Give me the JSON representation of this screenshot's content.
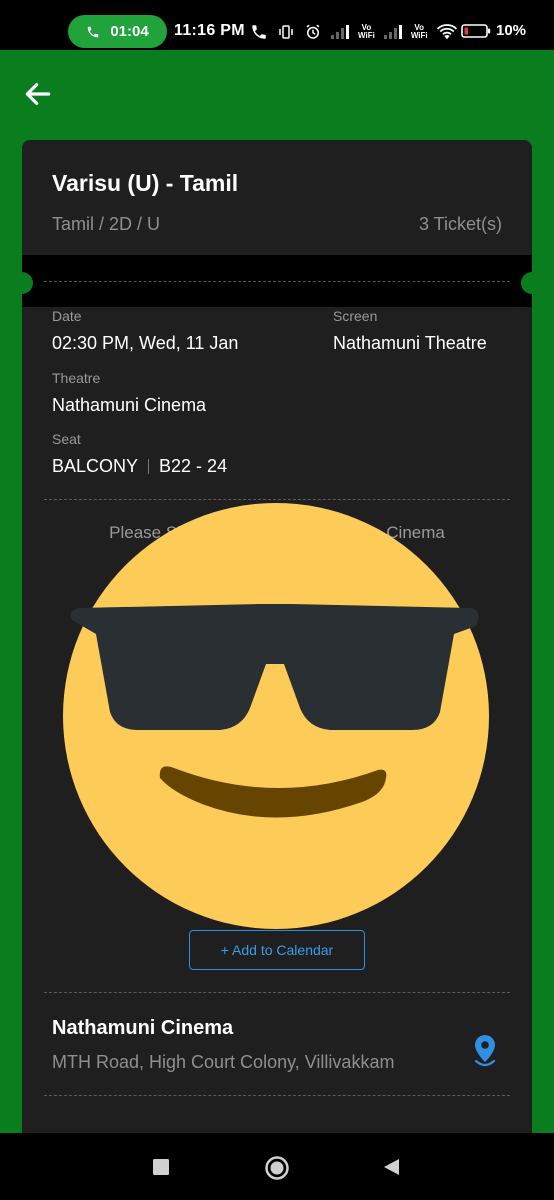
{
  "status_bar": {
    "call_timer": "01:04",
    "time": "11:16 PM",
    "volte_1": "Vo\nWiFi",
    "volte_2": "Vo\nWiFi",
    "battery": "10%"
  },
  "header": {
    "back_icon": "arrow-left-icon"
  },
  "ticket": {
    "title": "Varisu (U) - Tamil",
    "format": "Tamil / 2D / U",
    "count": "3 Ticket(s)",
    "date_label": "Date",
    "date_value": "02:30 PM, Wed, 11 Jan",
    "screen_label": "Screen",
    "screen_value": "Nathamuni Theatre",
    "theatre_label": "Theatre",
    "theatre_value": "Nathamuni Cinema",
    "seat_label": "Seat",
    "seat_class": "BALCONY",
    "seat_numbers": "B22 - 24",
    "show_text_left": "Please Sh",
    "show_text_right": "he Cinema",
    "calendar_button": "+ Add to Calendar"
  },
  "venue": {
    "name": "Nathamuni Cinema",
    "address": "MTH Road, High Court Colony, Villivakkam"
  },
  "colors": {
    "brand_green": "#0a7e1f",
    "card_bg": "#1f1f1f",
    "accent_blue": "#2f8fe0",
    "emoji_yellow": "#fdcb58"
  },
  "nav": {
    "icons": [
      "recent-apps-icon",
      "home-icon",
      "back-triangle-icon"
    ]
  }
}
